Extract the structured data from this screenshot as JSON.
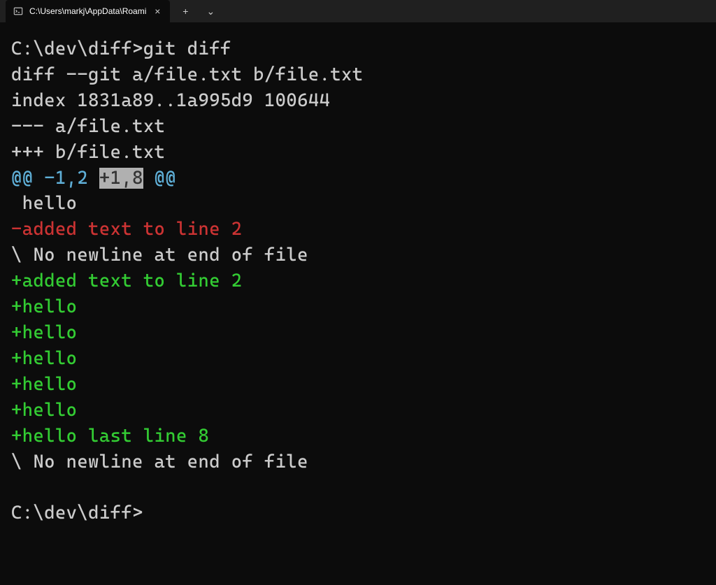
{
  "titlebar": {
    "tab_title": "C:\\Users\\markj\\AppData\\Roami",
    "close_glyph": "×",
    "new_tab_glyph": "+",
    "dropdown_glyph": "⌄"
  },
  "terminal": {
    "lines": [
      {
        "segments": [
          {
            "text": "C:\\dev\\diff>git diff",
            "cls": "white"
          }
        ]
      },
      {
        "segments": [
          {
            "text": "diff --git a/file.txt b/file.txt",
            "cls": "white"
          }
        ]
      },
      {
        "segments": [
          {
            "text": "index 1831a89..1a995d9 100644",
            "cls": "white"
          }
        ]
      },
      {
        "segments": [
          {
            "text": "--- a/file.txt",
            "cls": "white"
          }
        ]
      },
      {
        "segments": [
          {
            "text": "+++ b/file.txt",
            "cls": "white"
          }
        ]
      },
      {
        "segments": [
          {
            "text": "@@ -1,2 ",
            "cls": "cyan"
          },
          {
            "text": "+1,8",
            "cls": "cyan selected"
          },
          {
            "text": " @@",
            "cls": "cyan"
          }
        ]
      },
      {
        "segments": [
          {
            "text": " hello",
            "cls": "white"
          }
        ]
      },
      {
        "segments": [
          {
            "text": "-added text to line 2",
            "cls": "red"
          }
        ]
      },
      {
        "segments": [
          {
            "text": "\\ No newline at end of file",
            "cls": "white"
          }
        ]
      },
      {
        "segments": [
          {
            "text": "+added text to line 2",
            "cls": "green"
          }
        ]
      },
      {
        "segments": [
          {
            "text": "+hello",
            "cls": "green"
          }
        ]
      },
      {
        "segments": [
          {
            "text": "+hello",
            "cls": "green"
          }
        ]
      },
      {
        "segments": [
          {
            "text": "+hello",
            "cls": "green"
          }
        ]
      },
      {
        "segments": [
          {
            "text": "+hello",
            "cls": "green"
          }
        ]
      },
      {
        "segments": [
          {
            "text": "+hello",
            "cls": "green"
          }
        ]
      },
      {
        "segments": [
          {
            "text": "+hello last line 8",
            "cls": "green"
          }
        ]
      },
      {
        "segments": [
          {
            "text": "\\ No newline at end of file",
            "cls": "white"
          }
        ]
      },
      {
        "segments": [
          {
            "text": "",
            "cls": "white"
          }
        ]
      },
      {
        "segments": [
          {
            "text": "C:\\dev\\diff>",
            "cls": "white"
          }
        ]
      }
    ]
  }
}
